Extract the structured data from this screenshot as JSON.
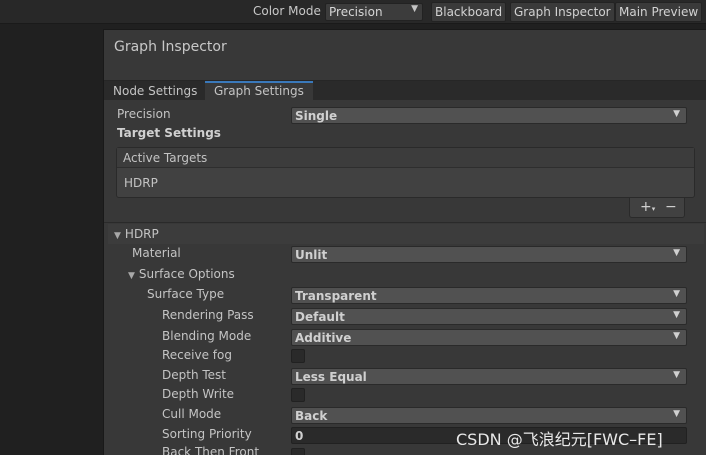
{
  "toolbar": {
    "color_mode_label": "Color Mode",
    "color_mode_value": "Precision",
    "buttons": [
      "Blackboard",
      "Graph Inspector",
      "Main Preview"
    ]
  },
  "inspector": {
    "title": "Graph Inspector",
    "tabs": [
      {
        "label": "Node Settings",
        "active": false
      },
      {
        "label": "Graph Settings",
        "active": true
      }
    ],
    "precision": {
      "label": "Precision",
      "value": "Single"
    },
    "target_settings_label": "Target Settings",
    "active_targets": {
      "header": "Active Targets",
      "items": [
        "HDRP"
      ]
    },
    "add_symbol": "+",
    "add_sub_symbol": "▾",
    "remove_symbol": "−",
    "hdrp_section": {
      "title": "HDRP",
      "material": {
        "label": "Material",
        "value": "Unlit"
      },
      "surface_options": {
        "title": "Surface Options",
        "surface_type": {
          "label": "Surface Type",
          "value": "Transparent"
        },
        "rendering_pass": {
          "label": "Rendering Pass",
          "value": "Default"
        },
        "blending_mode": {
          "label": "Blending Mode",
          "value": "Additive"
        },
        "receive_fog": {
          "label": "Receive fog",
          "checked": false
        },
        "depth_test": {
          "label": "Depth Test",
          "value": "Less Equal"
        },
        "depth_write": {
          "label": "Depth Write",
          "checked": false
        },
        "cull_mode": {
          "label": "Cull Mode",
          "value": "Back"
        },
        "sorting_priority": {
          "label": "Sorting Priority",
          "value": "0"
        },
        "back_then_front": {
          "label": "Back Then Front",
          "checked": false
        }
      }
    }
  },
  "watermark": "CSDN @飞浪纪元[FWC–FE]",
  "icons": {
    "dropdown_arrow": "▼",
    "foldout_expanded": "▼"
  },
  "colors": {
    "tab_accent": "#3a79bb",
    "panel_bg": "#383838",
    "toolbar_bg": "#282828"
  }
}
